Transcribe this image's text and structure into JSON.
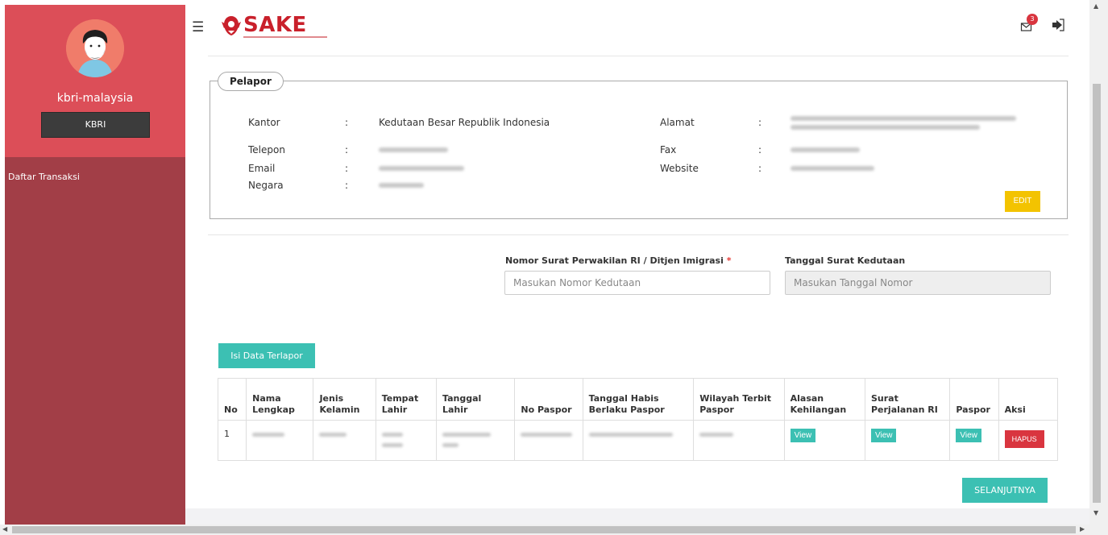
{
  "sidebar": {
    "username": "kbri-malaysia",
    "role": "KBRI",
    "menu": [
      {
        "label": "Daftar Transaksi"
      }
    ]
  },
  "header": {
    "logo_text": "SAKE",
    "mail_icon": "mail-icon",
    "mail_count": "3",
    "logout_icon": "logout-icon",
    "menu_icon": "hamburger-icon"
  },
  "pelapor": {
    "legend": "Pelapor",
    "kantor_label": "Kantor",
    "kantor_value": "Kedutaan Besar Republik Indonesia",
    "telepon_label": "Telepon",
    "email_label": "Email",
    "negara_label": "Negara",
    "alamat_label": "Alamat",
    "fax_label": "Fax",
    "website_label": "Website",
    "colon": ":",
    "edit_button": "EDIT"
  },
  "form": {
    "nomor_label": "Nomor Surat Perwakilan RI / Ditjen Imigrasi",
    "required_mark": "*",
    "nomor_placeholder": "Masukan Nomor Kedutaan",
    "tanggal_label": "Tanggal Surat Kedutaan",
    "tanggal_placeholder": "Masukan Tanggal Nomor"
  },
  "isi_button": "Isi Data Terlapor",
  "table": {
    "headers": [
      "No",
      "Nama Lengkap",
      "Jenis Kelamin",
      "Tempat Lahir",
      "Tanggal Lahir",
      "No Paspor",
      "Tanggal Habis Berlaku Paspor",
      "Wilayah Terbit Paspor",
      "Alasan Kehilangan",
      "Surat Perjalanan RI",
      "Paspor",
      "Aksi"
    ],
    "rows": [
      {
        "no": "1",
        "view1": "View",
        "view2": "View",
        "view3": "View",
        "hapus": "HAPUS"
      }
    ]
  },
  "selanjutnya_button": "SELANJUTNYA",
  "colors": {
    "sidebar_top": "#dc4e58",
    "sidebar": "#a23e47",
    "teal": "#3cc0b3",
    "edit_yellow": "#f3c300",
    "danger": "#d9353f"
  }
}
